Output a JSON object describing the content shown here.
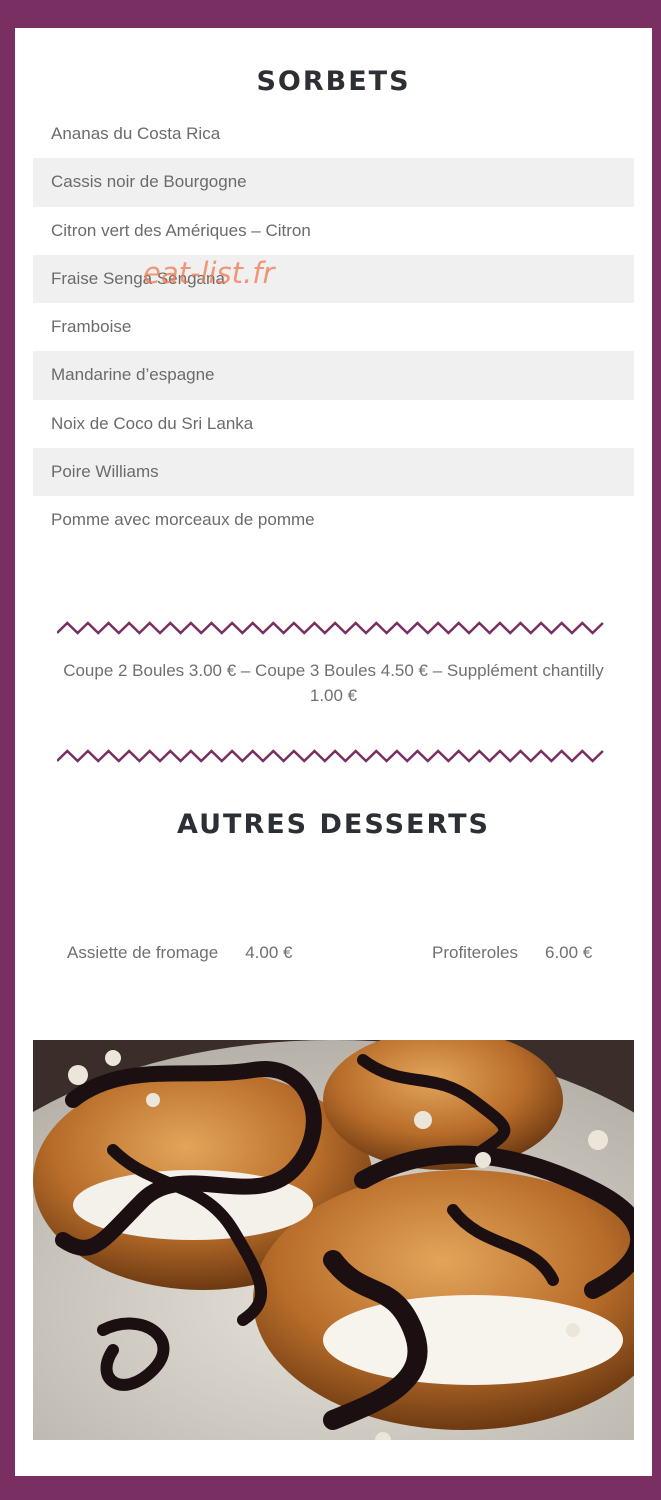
{
  "sorbets": {
    "title": "SORBETS",
    "items": [
      "Ananas du Costa Rica",
      "Cassis noir de Bourgogne",
      "Citron vert des Amériques – Citron",
      "Fraise Senga Sengana",
      "Framboise",
      "Mandarine d’espagne",
      "Noix de Coco du Sri Lanka",
      "Poire Williams",
      "Pomme avec morceaux de pomme"
    ]
  },
  "watermark": "eat-list.fr",
  "price_note": "Coupe 2 Boules 3.00 € – Coupe 3 Boules 4.50 € – Supplément chantilly 1.00 €",
  "desserts": {
    "title": "AUTRES DESSERTS",
    "items": [
      {
        "name": "Assiette de fromage",
        "price": "4.00 €"
      },
      {
        "name": "Profiteroles",
        "price": "6.00 €"
      }
    ]
  },
  "colors": {
    "background": "#7a2f63",
    "zigzag": "#7a2f63",
    "heading": "#2c2f33"
  }
}
